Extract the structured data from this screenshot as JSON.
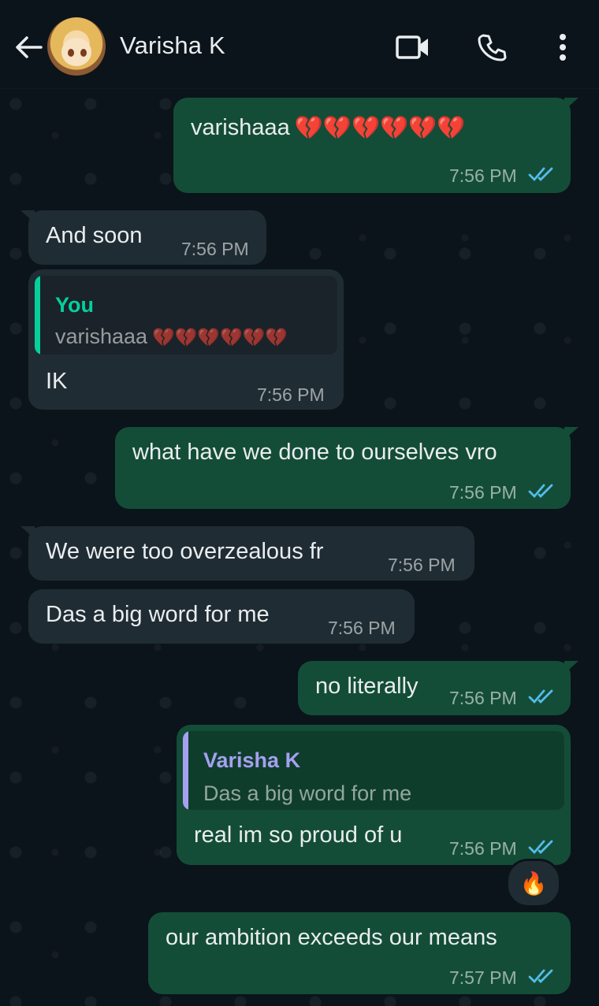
{
  "header": {
    "contact_name": "Varisha K",
    "icons": [
      "back-arrow-icon",
      "video-call-icon",
      "voice-call-icon",
      "more-options-icon"
    ]
  },
  "messages": [
    {
      "direction": "out",
      "text": "varishaaa",
      "emoji": "💔💔💔💔💔💔",
      "time": "7:56 PM",
      "status": "read"
    },
    {
      "direction": "in",
      "text": "And soon",
      "time": "7:56 PM"
    },
    {
      "direction": "in",
      "reply_to": {
        "name": "You",
        "text": "varishaaa",
        "emoji": "💔💔💔💔💔💔"
      },
      "text": "IK",
      "time": "7:56 PM"
    },
    {
      "direction": "out",
      "text": "what have we done to ourselves vro",
      "time": "7:56 PM",
      "status": "read"
    },
    {
      "direction": "in",
      "text": "We were too overzealous fr",
      "time": "7:56 PM"
    },
    {
      "direction": "in",
      "text": "Das a big word for me",
      "time": "7:56 PM"
    },
    {
      "direction": "out",
      "text": "no literally",
      "time": "7:56 PM",
      "status": "read"
    },
    {
      "direction": "out",
      "reply_to": {
        "name": "Varisha K",
        "text": "Das a big word for me"
      },
      "text": "real im so proud of u",
      "time": "7:56 PM",
      "status": "read",
      "reaction": "🔥"
    },
    {
      "direction": "out",
      "text": "our ambition exceeds our means",
      "time": "7:57 PM",
      "status": "read"
    }
  ],
  "colors": {
    "background": "#0b141a",
    "incoming_bubble": "#202c33",
    "outgoing_bubble": "#144d37",
    "read_ticks": "#53bdeb",
    "quote_you": "#06cf9c",
    "quote_contact": "#a5a0f0"
  }
}
